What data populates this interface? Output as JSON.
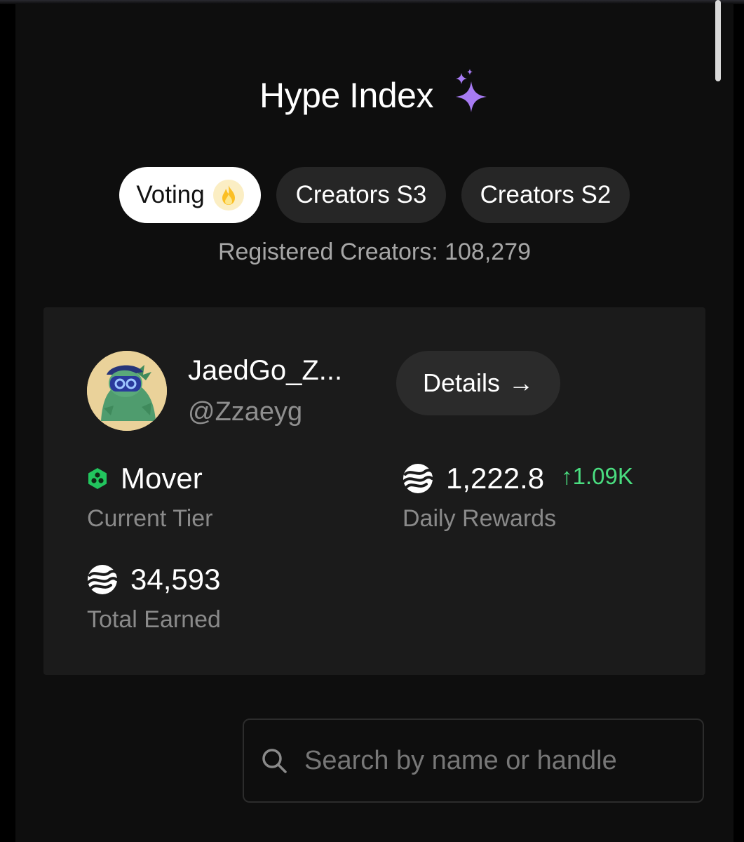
{
  "header": {
    "title": "Hype Index",
    "title_icon": "sparkle-icon"
  },
  "tabs": [
    {
      "label": "Voting",
      "active": true,
      "icon": "fire-icon"
    },
    {
      "label": "Creators S3",
      "active": false
    },
    {
      "label": "Creators S2",
      "active": false
    }
  ],
  "registered_creators": "Registered Creators: 108,279",
  "profile": {
    "display_name": "JaedGo_Z...",
    "handle": "@Zzaeyg",
    "details_label": "Details",
    "details_icon": "arrow-right-icon",
    "tier": {
      "value": "Mover",
      "label": "Current Tier",
      "icon": "hexagon-tier-icon",
      "color": "#22c55e"
    },
    "daily_rewards": {
      "value": "1,222.8",
      "change": "↑1.09K",
      "label": "Daily Rewards",
      "icon": "coin-icon"
    },
    "total_earned": {
      "value": "34,593",
      "label": "Total Earned",
      "icon": "coin-icon"
    }
  },
  "search": {
    "placeholder": "Search by name or handle",
    "icon": "search-icon"
  },
  "colors": {
    "accent_green": "#4ade80",
    "sparkle_purple": "#a77bf3",
    "background": "#0e0e0e",
    "card": "#1b1b1b"
  }
}
